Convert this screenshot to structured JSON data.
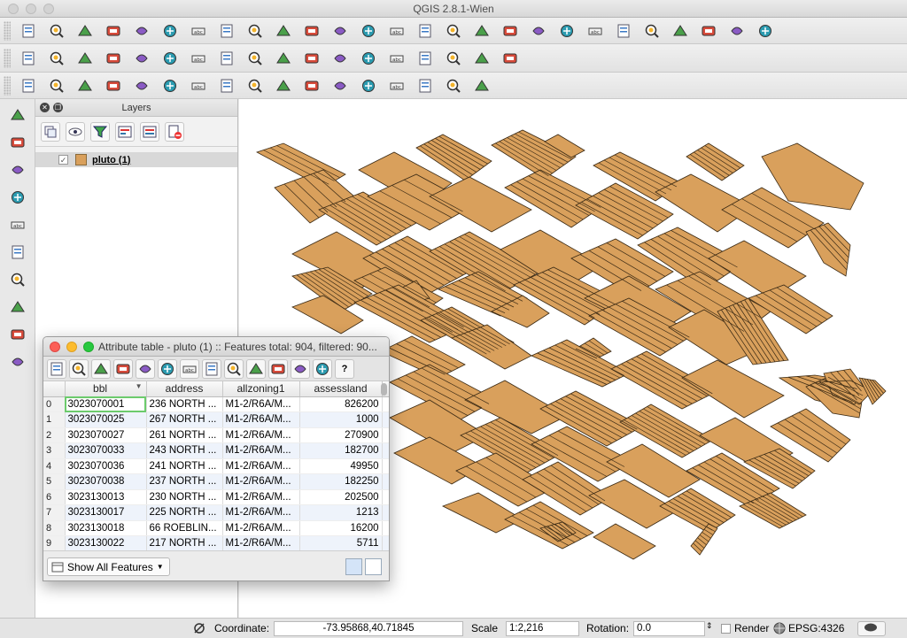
{
  "window": {
    "title": "QGIS 2.8.1-Wien"
  },
  "toolbar_icons": {
    "row1": [
      "new-project-icon",
      "open-project-icon",
      "save-project-icon",
      "save-as-icon",
      "print-composer-icon",
      "composer-manager-icon",
      "pan-icon",
      "pan-to-selection-icon",
      "zoom-in-icon",
      "zoom-out-icon",
      "zoom-actual-icon",
      "zoom-full-icon",
      "zoom-to-selection-icon",
      "zoom-to-layer-icon",
      "zoom-last-icon",
      "zoom-next-icon",
      "refresh-icon",
      "identify-icon",
      "select-icon",
      "deselect-icon",
      "field-calculator-icon",
      "attribute-table-icon",
      "statistics-icon",
      "measure-icon",
      "annotation-icon",
      "tip-icon",
      "help-icon"
    ],
    "row2": [
      "current-edits-icon",
      "toggle-editing-icon",
      "save-edits-icon",
      "add-feature-icon",
      "move-feature-icon",
      "node-tool-icon",
      "delete-selected-icon",
      "cut-features-icon",
      "copy-features-icon",
      "paste-features-icon",
      "label-icon",
      "pin-label-icon",
      "show-label-icon",
      "move-label-icon",
      "rotate-label-icon",
      "change-label-icon",
      "csw-icon",
      "python-icon"
    ],
    "row3": [
      "snapping-icon",
      "undo-icon",
      "redo-icon",
      "simplify-icon",
      "add-ring-icon",
      "add-part-icon",
      "fill-ring-icon",
      "delete-ring-icon",
      "delete-part-icon",
      "reshape-icon",
      "offset-curve-icon",
      "split-features-icon",
      "split-parts-icon",
      "merge-features-icon",
      "merge-attributes-icon",
      "rotate-point-icon",
      "rotate-feature-icon"
    ]
  },
  "left_toolbar_icons": [
    "add-vector-layer-icon",
    "add-raster-layer-icon",
    "add-postgis-layer-icon",
    "add-spatialite-layer-icon",
    "add-mssql-layer-icon",
    "add-wms-layer-icon",
    "add-wcs-layer-icon",
    "add-wfs-layer-icon",
    "add-delimited-text-icon",
    "new-vector-layer-icon"
  ],
  "layers_panel": {
    "title": "Layers",
    "layer": {
      "name": "pluto (1)",
      "checked": true,
      "color": "#d9a05c"
    }
  },
  "attribute_table": {
    "title": "Attribute table - pluto (1) :: Features total: 904, filtered: 90...",
    "columns": [
      "bbl",
      "address",
      "allzoning1",
      "assessland"
    ],
    "rows": [
      [
        "0",
        "3023070001",
        "236 NORTH ...",
        "M1-2/R6A/M...",
        "826200"
      ],
      [
        "1",
        "3023070025",
        "267 NORTH ...",
        "M1-2/R6A/M...",
        "1000"
      ],
      [
        "2",
        "3023070027",
        "261 NORTH ...",
        "M1-2/R6A/M...",
        "270900"
      ],
      [
        "3",
        "3023070033",
        "243 NORTH ...",
        "M1-2/R6A/M...",
        "182700"
      ],
      [
        "4",
        "3023070036",
        "241 NORTH ...",
        "M1-2/R6A/M...",
        "49950"
      ],
      [
        "5",
        "3023070038",
        "237 NORTH ...",
        "M1-2/R6A/M...",
        "182250"
      ],
      [
        "6",
        "3023130013",
        "230 NORTH ...",
        "M1-2/R6A/M...",
        "202500"
      ],
      [
        "7",
        "3023130017",
        "225 NORTH ...",
        "M1-2/R6A/M...",
        "1213"
      ],
      [
        "8",
        "3023130018",
        "66 ROEBLIN...",
        "M1-2/R6A/M...",
        "16200"
      ],
      [
        "9",
        "3023130022",
        "217 NORTH ...",
        "M1-2/R6A/M...",
        "5711"
      ]
    ],
    "show_all_label": "Show All Features"
  },
  "statusbar": {
    "coordinate_label": "Coordinate:",
    "coordinate_value": "-73.95868,40.71845",
    "scale_label": "Scale",
    "scale_value": "1:2,216",
    "rotation_label": "Rotation:",
    "rotation_value": "0.0",
    "render_label": "Render",
    "crs_label": "EPSG:4326"
  },
  "colors": {
    "parcel_fill": "#d9a05c",
    "parcel_stroke": "#3b2a14"
  }
}
